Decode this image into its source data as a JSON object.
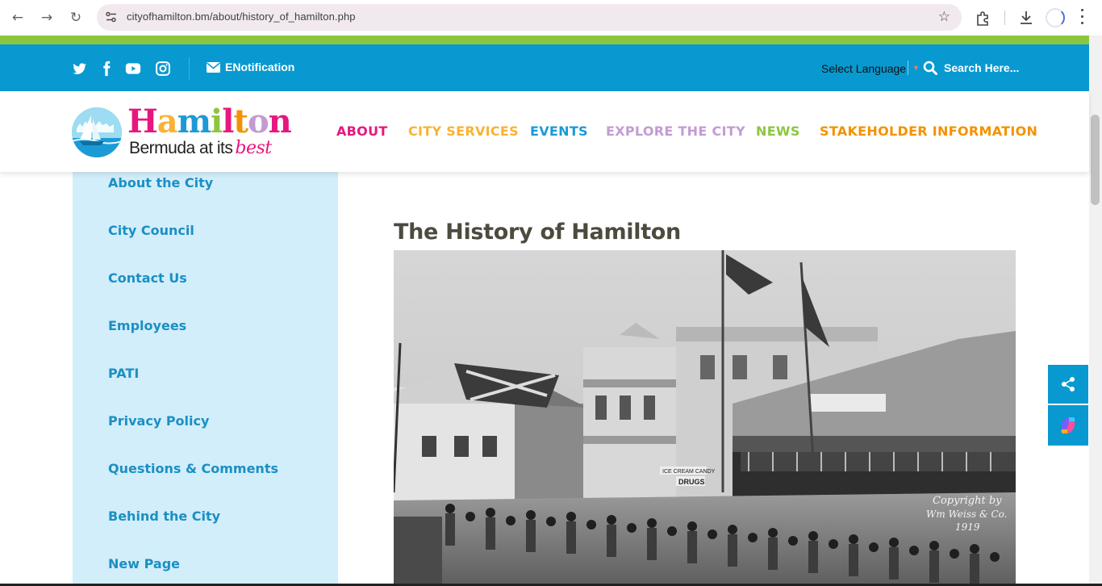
{
  "browser": {
    "url": "cityofhamilton.bm/about/history_of_hamilton.php"
  },
  "topbar": {
    "enotification_label": "ENotification",
    "language_label": "Select Language",
    "search_label": "Search Here..."
  },
  "logo": {
    "letters": [
      "H",
      "a",
      "m",
      "i",
      "l",
      "t",
      "o",
      "n"
    ],
    "letter_colors": [
      "#e6177f",
      "#f9b234",
      "#1b9ad6",
      "#8cc63f",
      "#e6177f",
      "#f39200",
      "#c39bd3",
      "#e6177f"
    ],
    "tagline": "Bermuda at its",
    "tagline_accent": "best"
  },
  "nav": [
    {
      "label": "ABOUT",
      "color": "#e6177f"
    },
    {
      "label": "CITY SERVICES",
      "color": "#f9b234"
    },
    {
      "label": "EVENTS",
      "color": "#1b9ad6"
    },
    {
      "label": "EXPLORE THE CITY",
      "color": "#c39bd3"
    },
    {
      "label": "NEWS",
      "color": "#8cc63f"
    },
    {
      "label": "STAKEHOLDER INFORMATION",
      "color": "#f39200"
    }
  ],
  "sidebar": {
    "items": [
      {
        "label": "About the City"
      },
      {
        "label": "City Council"
      },
      {
        "label": "Contact Us"
      },
      {
        "label": "Employees"
      },
      {
        "label": "PATI"
      },
      {
        "label": "Privacy Policy"
      },
      {
        "label": "Questions & Comments"
      },
      {
        "label": "Behind the City"
      },
      {
        "label": "New Page"
      }
    ]
  },
  "main": {
    "title": "The History of Hamilton",
    "photo": {
      "sign_drugs": "DRUGS",
      "sign_icecream": "ICE CREAM CANDY",
      "copyright_line1": "Copyright by",
      "copyright_line2": "Wm Weiss & Co.",
      "copyright_line3": "1919"
    }
  },
  "colors": {
    "brand_blue": "#0899d1",
    "brand_green": "#8cc63f",
    "sidebar_bg": "#d2eefa",
    "sidebar_text": "#1b8fc4"
  }
}
